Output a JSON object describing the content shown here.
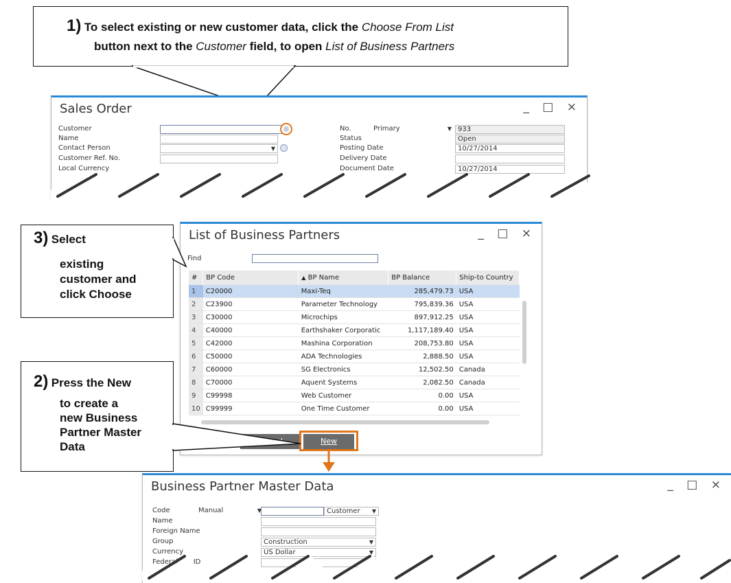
{
  "callouts": {
    "c1": {
      "num": "1)",
      "line1_a": "To select existing or new customer data, click the ",
      "line1_b": "Choose From List",
      "line2_a": "button next to the ",
      "line2_b": "Customer",
      "line2_c": " field, to open ",
      "line2_d": "List of Business Partners"
    },
    "c3": {
      "num": "3)",
      "l1": "Select",
      "l2": "existing",
      "l3": "customer and",
      "l4": "click Choose"
    },
    "c2": {
      "num": "2)",
      "l1": "Press the New",
      "l2": "to create a",
      "l3": "new Business",
      "l4": "Partner Master",
      "l5": "Data"
    }
  },
  "sales_order": {
    "title": "Sales Order",
    "controls": "_ □ ×",
    "labels": {
      "customer": "Customer",
      "name": "Name",
      "contact": "Contact Person",
      "ref": "Customer Ref. No.",
      "local": "Local Currency"
    },
    "right": {
      "no": "No.",
      "series": "Primary",
      "number": "933",
      "status_label": "Status",
      "status": "Open",
      "posting_label": "Posting Date",
      "posting": "10/27/2014",
      "delivery_label": "Delivery Date",
      "document_label": "Document Date",
      "document": "10/27/2014"
    }
  },
  "bp_list": {
    "title": "List of Business Partners",
    "controls": "_ □ ×",
    "find_label": "Find",
    "headers": {
      "num": "#",
      "code": "BP Code",
      "name": "BP Name",
      "balance": "BP Balance",
      "country": "Ship-to Country"
    },
    "rows": [
      {
        "n": "1",
        "code": "C20000",
        "name": "Maxi-Teq",
        "balance": "285,479.73",
        "country": "USA"
      },
      {
        "n": "2",
        "code": "C23900",
        "name": "Parameter Technology",
        "balance": "795,839.36",
        "country": "USA"
      },
      {
        "n": "3",
        "code": "C30000",
        "name": "Microchips",
        "balance": "897,912.25",
        "country": "USA"
      },
      {
        "n": "4",
        "code": "C40000",
        "name": "Earthshaker Corporatic",
        "balance": "1,117,189.40",
        "country": "USA"
      },
      {
        "n": "5",
        "code": "C42000",
        "name": "Mashina Corporation",
        "balance": "208,753.80",
        "country": "USA"
      },
      {
        "n": "6",
        "code": "C50000",
        "name": "ADA Technologies",
        "balance": "2,888.50",
        "country": "USA"
      },
      {
        "n": "7",
        "code": "C60000",
        "name": "SG Electronics",
        "balance": "12,502.50",
        "country": "Canada"
      },
      {
        "n": "8",
        "code": "C70000",
        "name": "Aquent Systems",
        "balance": "2,082.50",
        "country": "Canada"
      },
      {
        "n": "9",
        "code": "C99998",
        "name": "Web Customer",
        "balance": "0.00",
        "country": "USA"
      },
      {
        "n": "10",
        "code": "C99999",
        "name": "One Time Customer",
        "balance": "0.00",
        "country": "USA"
      }
    ],
    "buttons": {
      "cancel": "Cancel",
      "new": "New"
    }
  },
  "bp_master": {
    "title": "Business Partner Master Data",
    "controls": "_ □ ×",
    "labels": {
      "code": "Code",
      "name": "Name",
      "foreign": "Foreign Name",
      "group": "Group",
      "currency": "Currency",
      "federal": "Federal Tax ID"
    },
    "values": {
      "series": "Manual",
      "type": "Customer",
      "group": "Construction",
      "currency": "US Dollar"
    }
  },
  "colors": {
    "accent": "#2a8ad8",
    "highlight_orange": "#e0761c",
    "row_highlight": "#c9dcf3"
  }
}
